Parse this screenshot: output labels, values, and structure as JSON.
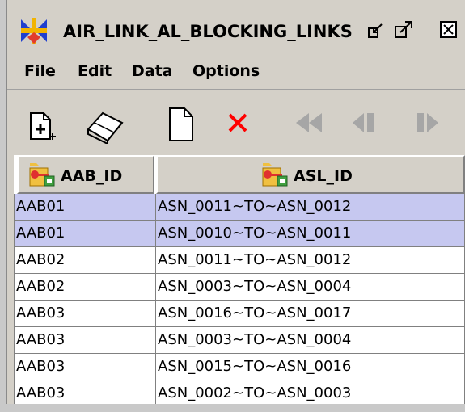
{
  "window": {
    "title": "AIR_LINK_AL_BLOCKING_LINKS",
    "icon": "app-logo-icon",
    "controls": [
      "minimize-icon",
      "maximize-icon",
      "close-icon"
    ]
  },
  "menu": {
    "items": [
      "File",
      "Edit",
      "Data",
      "Options"
    ]
  },
  "toolbar": {
    "buttons": [
      "insert-record-icon",
      "eraser-icon",
      "new-document-icon",
      "delete-icon",
      "first-record-icon",
      "previous-record-icon",
      "next-record-icon"
    ],
    "delete_color": "#ff0000",
    "disabled_color": "#a6a6a6"
  },
  "table": {
    "columns": [
      {
        "label": "AAB_ID",
        "icon": "primary-key-icon"
      },
      {
        "label": "ASL_ID",
        "icon": "primary-key-icon"
      }
    ],
    "selected_color": "#c6c8f0",
    "rows": [
      {
        "aab_id": "AAB01",
        "asl_id": "ASN_0011~TO~ASN_0012",
        "selected": true
      },
      {
        "aab_id": "AAB01",
        "asl_id": "ASN_0010~TO~ASN_0011",
        "selected": true
      },
      {
        "aab_id": "AAB02",
        "asl_id": "ASN_0011~TO~ASN_0012",
        "selected": false
      },
      {
        "aab_id": "AAB02",
        "asl_id": "ASN_0003~TO~ASN_0004",
        "selected": false
      },
      {
        "aab_id": "AAB03",
        "asl_id": "ASN_0016~TO~ASN_0017",
        "selected": false
      },
      {
        "aab_id": "AAB03",
        "asl_id": "ASN_0003~TO~ASN_0004",
        "selected": false
      },
      {
        "aab_id": "AAB03",
        "asl_id": "ASN_0015~TO~ASN_0016",
        "selected": false
      },
      {
        "aab_id": "AAB03",
        "asl_id": "ASN_0002~TO~ASN_0003",
        "selected": false
      }
    ]
  }
}
